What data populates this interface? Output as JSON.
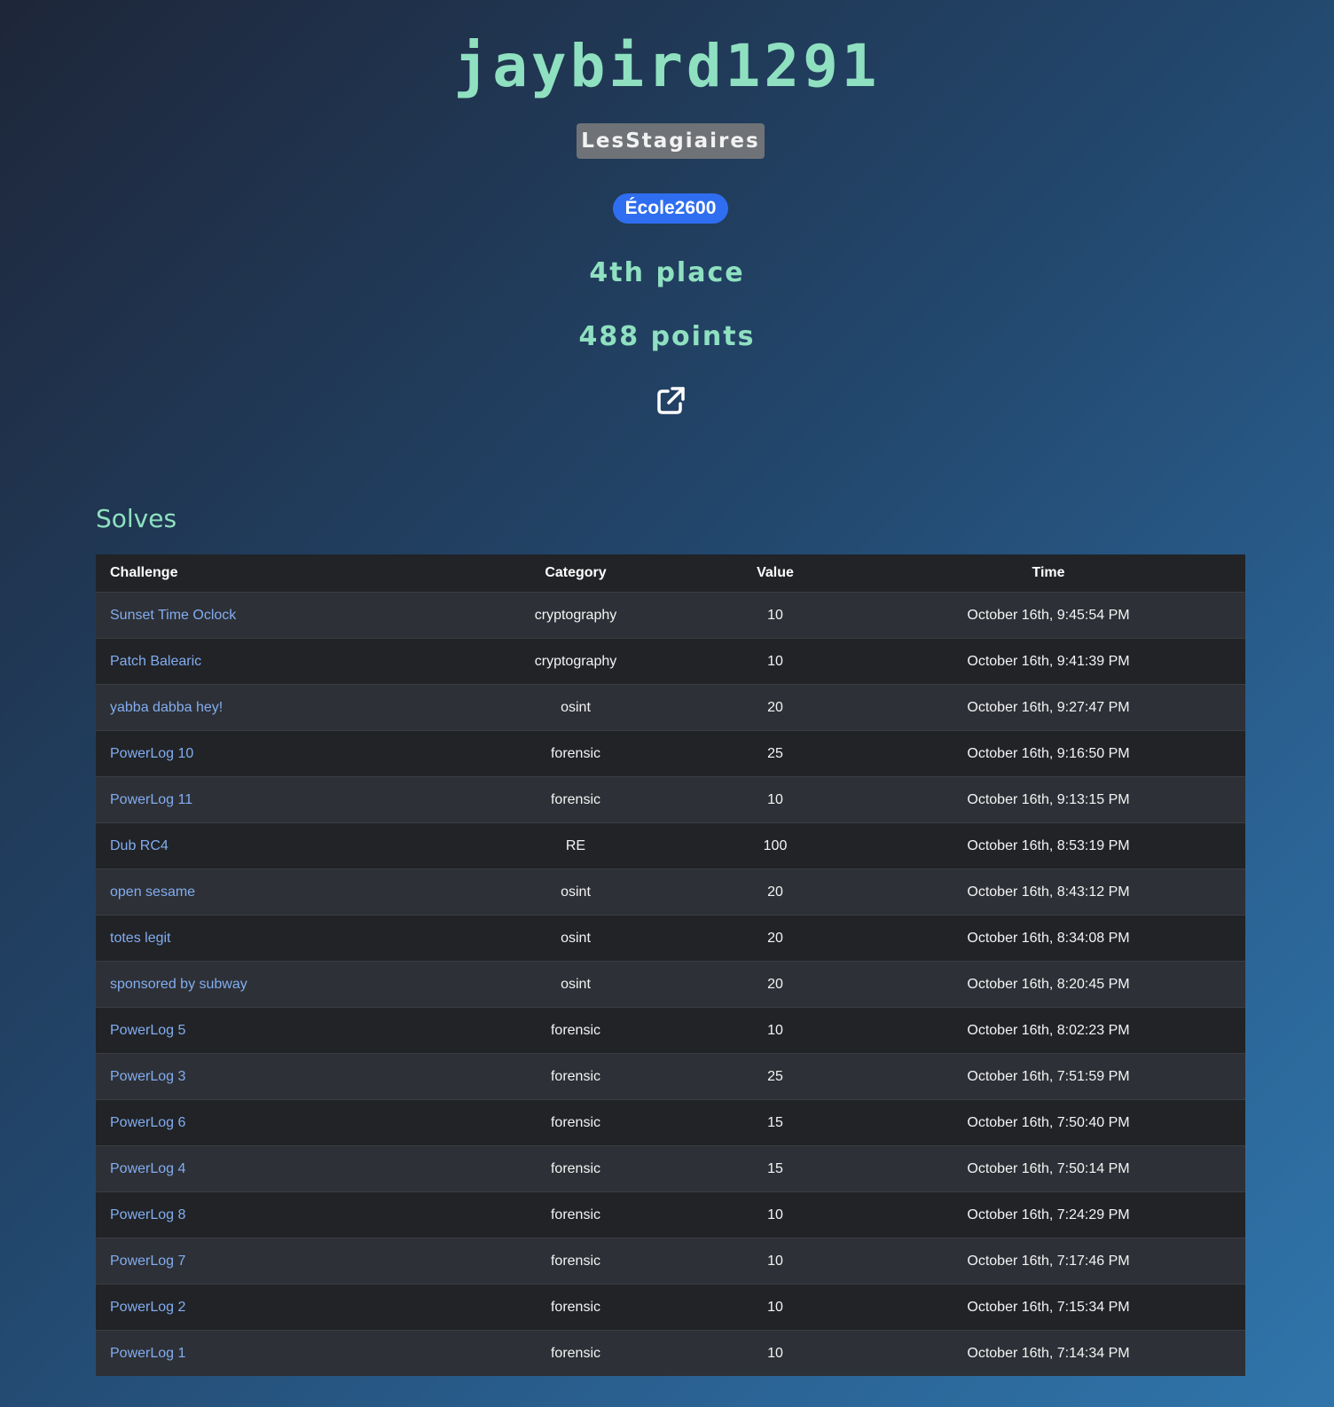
{
  "profile": {
    "name": "jaybird1291",
    "team": "LesStagiaires",
    "affiliation": "École2600",
    "place": "4th place",
    "points": "488 points",
    "link_icon": "external-link-icon"
  },
  "solves": {
    "title": "Solves",
    "headers": {
      "challenge": "Challenge",
      "category": "Category",
      "value": "Value",
      "time": "Time"
    },
    "rows": [
      {
        "challenge": "Sunset Time Oclock",
        "category": "cryptography",
        "value": "10",
        "time": "October 16th, 9:45:54 PM"
      },
      {
        "challenge": "Patch Balearic",
        "category": "cryptography",
        "value": "10",
        "time": "October 16th, 9:41:39 PM"
      },
      {
        "challenge": "yabba dabba hey!",
        "category": "osint",
        "value": "20",
        "time": "October 16th, 9:27:47 PM"
      },
      {
        "challenge": "PowerLog 10",
        "category": "forensic",
        "value": "25",
        "time": "October 16th, 9:16:50 PM"
      },
      {
        "challenge": "PowerLog 11",
        "category": "forensic",
        "value": "10",
        "time": "October 16th, 9:13:15 PM"
      },
      {
        "challenge": "Dub RC4",
        "category": "RE",
        "value": "100",
        "time": "October 16th, 8:53:19 PM"
      },
      {
        "challenge": "open sesame",
        "category": "osint",
        "value": "20",
        "time": "October 16th, 8:43:12 PM"
      },
      {
        "challenge": "totes legit",
        "category": "osint",
        "value": "20",
        "time": "October 16th, 8:34:08 PM"
      },
      {
        "challenge": "sponsored by subway",
        "category": "osint",
        "value": "20",
        "time": "October 16th, 8:20:45 PM"
      },
      {
        "challenge": "PowerLog 5",
        "category": "forensic",
        "value": "10",
        "time": "October 16th, 8:02:23 PM"
      },
      {
        "challenge": "PowerLog 3",
        "category": "forensic",
        "value": "25",
        "time": "October 16th, 7:51:59 PM"
      },
      {
        "challenge": "PowerLog 6",
        "category": "forensic",
        "value": "15",
        "time": "October 16th, 7:50:40 PM"
      },
      {
        "challenge": "PowerLog 4",
        "category": "forensic",
        "value": "15",
        "time": "October 16th, 7:50:14 PM"
      },
      {
        "challenge": "PowerLog 8",
        "category": "forensic",
        "value": "10",
        "time": "October 16th, 7:24:29 PM"
      },
      {
        "challenge": "PowerLog 7",
        "category": "forensic",
        "value": "10",
        "time": "October 16th, 7:17:46 PM"
      },
      {
        "challenge": "PowerLog 2",
        "category": "forensic",
        "value": "10",
        "time": "October 16th, 7:15:34 PM"
      },
      {
        "challenge": "PowerLog 1",
        "category": "forensic",
        "value": "10",
        "time": "October 16th, 7:14:34 PM"
      }
    ]
  },
  "colors": {
    "accent": "#8fe0c0",
    "link": "#82adf0",
    "team_badge": "#6f7377",
    "affiliation_badge": "#2f6ef0"
  }
}
